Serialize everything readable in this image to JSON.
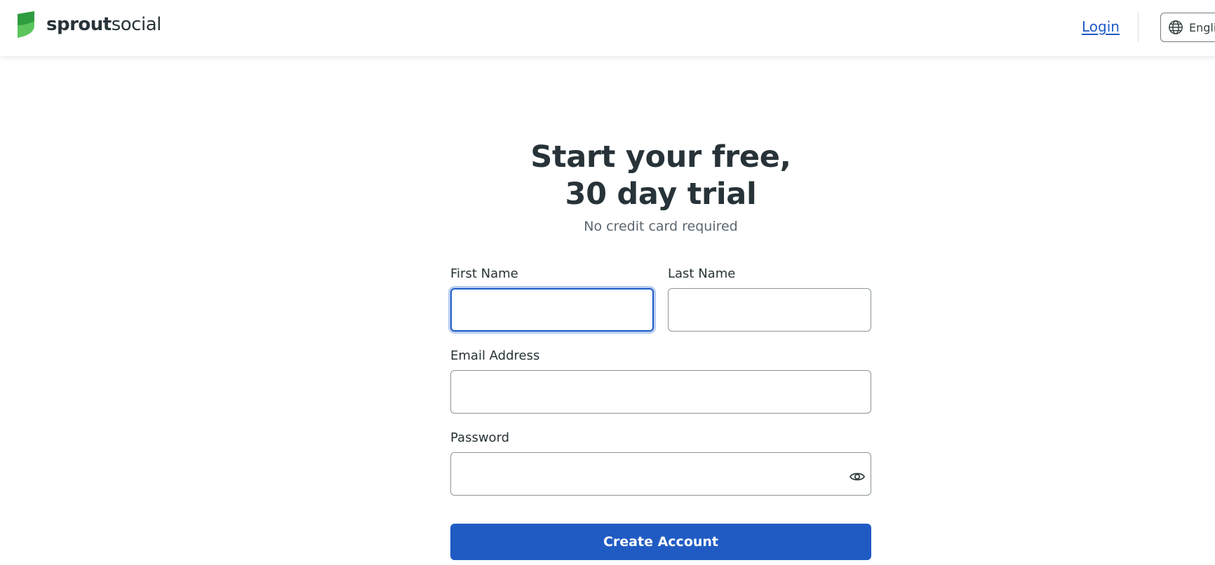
{
  "header": {
    "logo": {
      "bold": "sprout",
      "light": "social",
      "leaf_color_dark": "#2f9c3f",
      "leaf_color_light": "#5bc55b"
    },
    "login_label": "Login",
    "language_label": "English",
    "language_icon": "globe-icon"
  },
  "main": {
    "title_line1": "Start your free,",
    "title_line2": "30 day trial",
    "subtitle": "No credit card required"
  },
  "form": {
    "first_name": {
      "label": "First Name",
      "value": "",
      "placeholder": ""
    },
    "last_name": {
      "label": "Last Name",
      "value": "",
      "placeholder": ""
    },
    "email": {
      "label": "Email Address",
      "value": "",
      "placeholder": ""
    },
    "password": {
      "label": "Password",
      "value": "",
      "placeholder": "",
      "toggle_icon": "eye-icon"
    },
    "submit_label": "Create Account"
  },
  "colors": {
    "accent": "#205bc4",
    "text": "#273338",
    "muted": "#5b6670"
  }
}
